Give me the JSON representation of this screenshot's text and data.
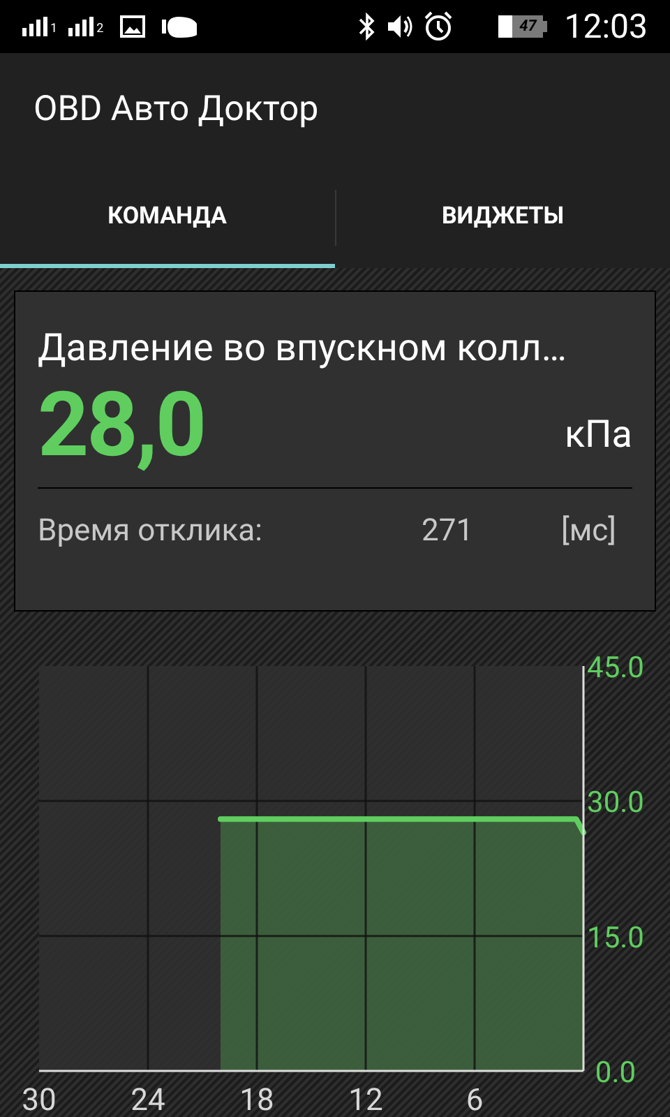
{
  "status_bar": {
    "sim_1": "1",
    "sim_2": "2",
    "battery": "47",
    "time": "12:03"
  },
  "app_bar": {
    "title": "OBD Авто Доктор"
  },
  "tabs": [
    {
      "label": "КОМАНДА",
      "selected": true
    },
    {
      "label": "ВИДЖЕТЫ",
      "selected": false
    }
  ],
  "card": {
    "title": "Давление во впускном колл…",
    "value": "28,0",
    "unit": "кПа",
    "response_label": "Время отклика:",
    "response_value": "271",
    "response_unit": "[мс]"
  },
  "chart": {
    "chart_data": {
      "type": "area",
      "grid": true,
      "x": [
        20,
        0.4,
        0
      ],
      "xlim": [
        30,
        0
      ],
      "ylim": [
        0,
        45
      ],
      "xticks": [
        30,
        24,
        18,
        12,
        6
      ],
      "yticks": [
        {
          "value": 45,
          "label": "45.0"
        },
        {
          "value": 30,
          "label": "30.0"
        },
        {
          "value": 15,
          "label": "15.0"
        },
        {
          "value": 0,
          "label": "0.0"
        }
      ],
      "series": [
        {
          "color": "#5fce5f",
          "values": [
            28,
            28,
            26.5
          ]
        }
      ]
    }
  }
}
